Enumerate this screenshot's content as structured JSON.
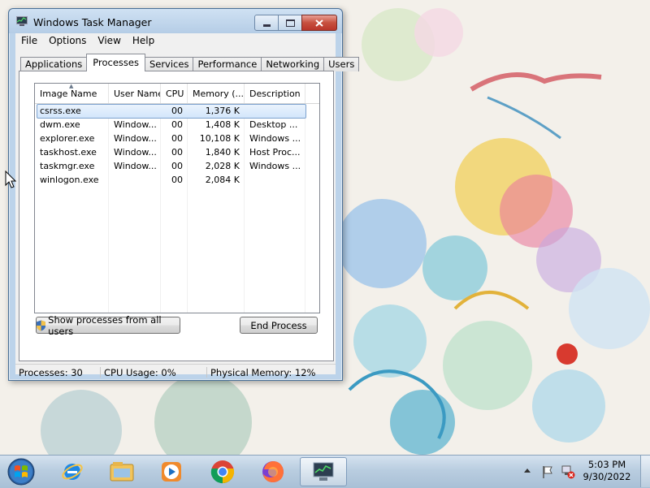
{
  "window": {
    "title": "Windows Task Manager",
    "menu": [
      "File",
      "Options",
      "View",
      "Help"
    ],
    "tabs": [
      "Applications",
      "Processes",
      "Services",
      "Performance",
      "Networking",
      "Users"
    ],
    "active_tab": "Processes"
  },
  "processes": {
    "columns": [
      "Image Name",
      "User Name",
      "CPU",
      "Memory (...",
      "Description"
    ],
    "rows": [
      {
        "image": "csrss.exe",
        "user": "",
        "cpu": "00",
        "memory": "1,376 K",
        "description": ""
      },
      {
        "image": "dwm.exe",
        "user": "Window...",
        "cpu": "00",
        "memory": "1,408 K",
        "description": "Desktop ..."
      },
      {
        "image": "explorer.exe",
        "user": "Window...",
        "cpu": "00",
        "memory": "10,108 K",
        "description": "Windows ..."
      },
      {
        "image": "taskhost.exe",
        "user": "Window...",
        "cpu": "00",
        "memory": "1,840 K",
        "description": "Host Proc..."
      },
      {
        "image": "taskmgr.exe",
        "user": "Window...",
        "cpu": "00",
        "memory": "2,028 K",
        "description": "Windows ..."
      },
      {
        "image": "winlogon.exe",
        "user": "",
        "cpu": "00",
        "memory": "2,084 K",
        "description": ""
      }
    ],
    "selected_row": 0,
    "show_all_button": "Show processes from all users",
    "end_process_button": "End Process"
  },
  "statusbar": {
    "processes": "Processes: 30",
    "cpu_usage": "CPU Usage: 0%",
    "physical_memory": "Physical Memory: 12%"
  },
  "taskbar": {
    "pinned": [
      "internet-explorer-icon",
      "windows-explorer-icon",
      "media-player-icon",
      "chrome-icon",
      "firefox-icon",
      "task-manager-icon"
    ],
    "active_app": "task-manager-icon",
    "time": "5:03 PM",
    "date": "9/30/2022"
  },
  "colors": {
    "selection": "#d3e6fb",
    "taskbar": "#b9cde0",
    "window_frame": "#bcd3ea"
  }
}
